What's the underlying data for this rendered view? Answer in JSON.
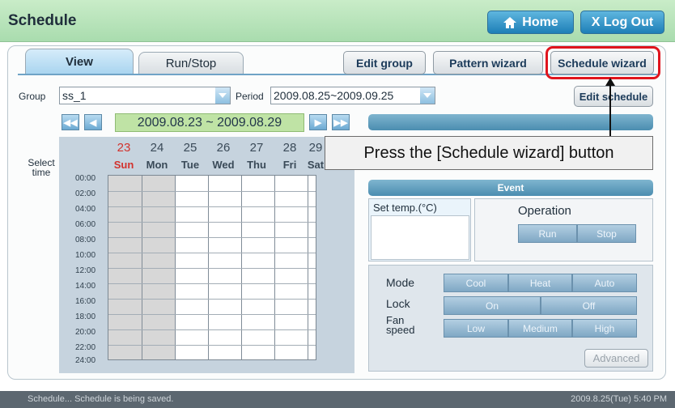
{
  "header": {
    "title": "Schedule",
    "home_label": "Home",
    "logout_label": "X Log Out"
  },
  "tabs": [
    {
      "label": "View",
      "active": true
    },
    {
      "label": "Run/Stop",
      "active": false
    }
  ],
  "toolbar": {
    "edit_group": "Edit group",
    "pattern_wizard": "Pattern wizard",
    "schedule_wizard": "Schedule wizard",
    "edit_schedule": "Edit schedule"
  },
  "filters": {
    "group_label": "Group",
    "group_value": "ss_1",
    "period_label": "Period",
    "period_value": "2009.08.25~2009.09.25"
  },
  "calendar": {
    "range": "2009.08.23 ~ 2009.08.29",
    "select_time": "Select time",
    "day_numbers": [
      "23",
      "24",
      "25",
      "26",
      "27",
      "28",
      "29"
    ],
    "day_names": [
      "Sun",
      "Mon",
      "Tue",
      "Wed",
      "Thu",
      "Fri",
      "Sat"
    ],
    "hours": [
      "00:00",
      "02:00",
      "04:00",
      "06:00",
      "08:00",
      "10:00",
      "12:00",
      "14:00",
      "16:00",
      "18:00",
      "20:00",
      "22:00",
      "24:00"
    ]
  },
  "callout": {
    "text": "Press the [Schedule wizard] button"
  },
  "event": {
    "title": "Event",
    "set_temp_label": "Set temp.(°C)",
    "operation_label": "Operation",
    "run": "Run",
    "stop": "Stop",
    "mode_label": "Mode",
    "modes": [
      "Cool",
      "Heat",
      "Auto"
    ],
    "lock_label": "Lock",
    "lock_options": [
      "On",
      "Off"
    ],
    "fan_label_1": "Fan",
    "fan_label_2": "speed",
    "fan_options": [
      "Low",
      "Medium",
      "High"
    ],
    "advanced": "Advanced"
  },
  "status": {
    "message": "Schedule...  Schedule is being saved.",
    "datetime": "2009.8.25(Tue)  5:40 PM"
  },
  "colors": {
    "sunday": "#d2322d",
    "highlight": "#e0141d",
    "accent": "#1d7fb7"
  }
}
